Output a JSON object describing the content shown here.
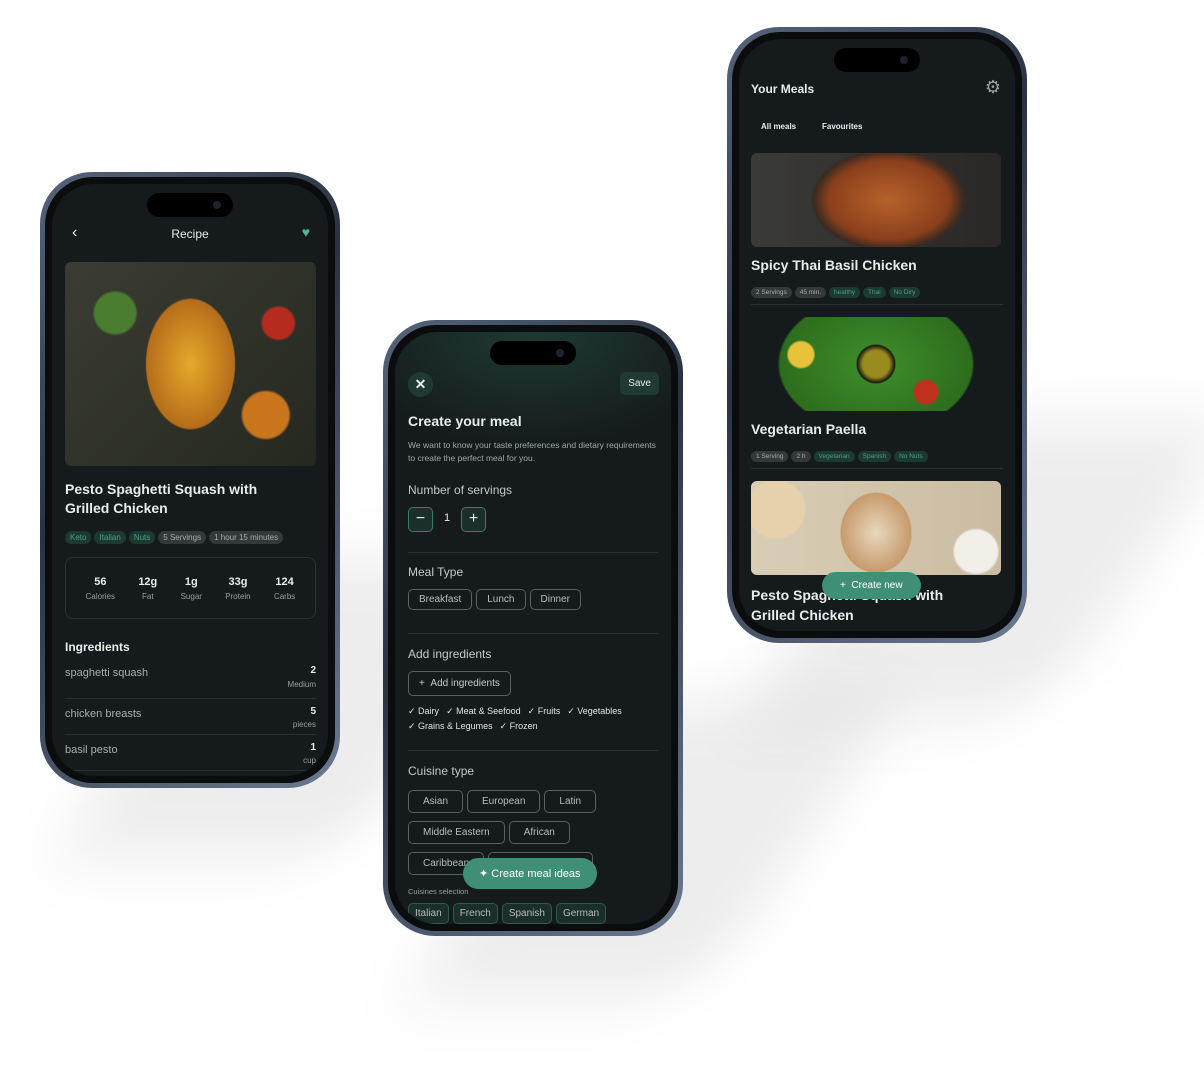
{
  "recipe": {
    "back_icon": "chevron-left-icon",
    "title": "Recipe",
    "fav_icon": "heart-icon",
    "meal_title": "Pesto Spaghetti Squash with Grilled Chicken",
    "tags": [
      "Keto",
      "Italian",
      "Nuts",
      "5 Servings",
      "1 hour 15 minutes"
    ],
    "nutrition": [
      {
        "value": "56",
        "label": "Calories"
      },
      {
        "value": "12g",
        "label": "Fat"
      },
      {
        "value": "1g",
        "label": "Sugar"
      },
      {
        "value": "33g",
        "label": "Protein"
      },
      {
        "value": "124",
        "label": "Carbs"
      }
    ],
    "ingredients_heading": "Ingredients",
    "ingredients": [
      {
        "name": "spaghetti squash",
        "qty": "2",
        "unit": "Medium"
      },
      {
        "name": "chicken breasts",
        "qty": "5",
        "unit": "pieces"
      },
      {
        "name": "basil pesto",
        "qty": "1",
        "unit": "cup"
      }
    ]
  },
  "create": {
    "close_icon": "close-icon",
    "save": "Save",
    "title": "Create your meal",
    "description": "We want to know your taste preferences and dietary requirements to create the perfect meal for you.",
    "servings_label": "Number of servings",
    "servings": "1",
    "meal_type_label": "Meal Type",
    "meal_types": [
      "Breakfast",
      "Lunch",
      "Dinner"
    ],
    "ingredients_label": "Add ingredients",
    "add_button": "Add ingredients",
    "categories": [
      "Dairy",
      "Meat & Seefood",
      "Fruits",
      "Vegetables",
      "Grains & Legumes",
      "Frozen"
    ],
    "cuisine_label": "Cuisine type",
    "cuisines": [
      "Asian",
      "European",
      "Latin",
      "Middle Eastern",
      "African",
      "Caribbean",
      ""
    ],
    "selection_label": "Cuisines selection",
    "selected": [
      "Italian",
      "French",
      "Spanish",
      "German"
    ],
    "fab": "Create meal ideas"
  },
  "meals": {
    "title": "Your Meals",
    "settings_icon": "gear-icon",
    "tabs": [
      "All meals",
      "Favourites"
    ],
    "items": [
      {
        "title": "Spicy Thai Basil Chicken",
        "tags": [
          "2 Servings",
          "45 min.",
          "healthy",
          "Thai",
          "No Diry"
        ]
      },
      {
        "title": "Vegetarian Paella",
        "tags": [
          "1 Serving",
          "2 h",
          "Vegetarian",
          "Spanish",
          "No Nuts"
        ]
      },
      {
        "title": "Pesto Spaghetti Squash with Grilled Chicken"
      }
    ],
    "fab": "Create new"
  },
  "colors": {
    "accent": "#3f8f76",
    "background": "#151a1c"
  }
}
